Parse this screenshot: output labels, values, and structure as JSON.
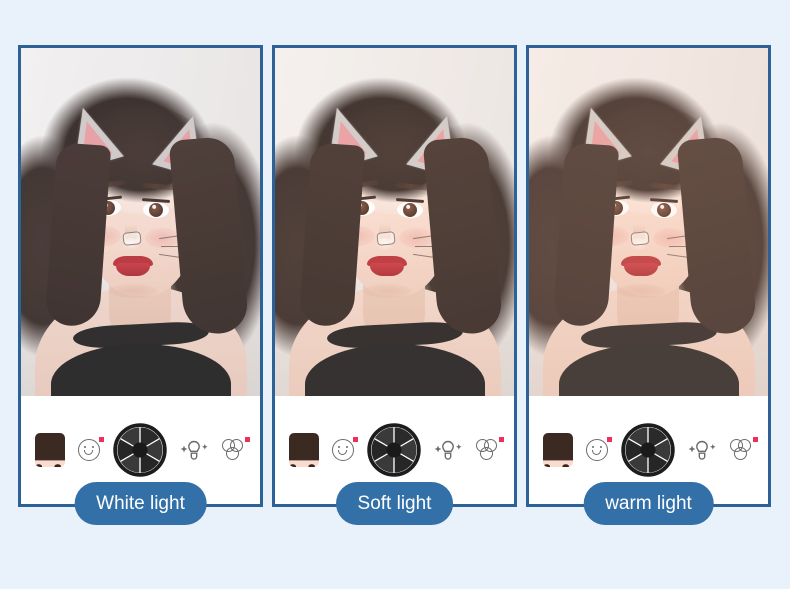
{
  "page": {
    "background_color": "#e9f1fa",
    "panel_border_color": "#2c6298",
    "pill_color": "#3470a8",
    "badge_color": "#ef2f55"
  },
  "panels": [
    {
      "id": "white-light",
      "label": "White light",
      "tint": "white",
      "toolbar": {
        "gallery": "gallery-thumbnail",
        "effects": "smiley-effects-icon",
        "shutter": "camera-shutter-button",
        "beauty": "beauty-wand-icon",
        "filters": "color-filters-icon"
      }
    },
    {
      "id": "soft-light",
      "label": "Soft light",
      "tint": "soft",
      "toolbar": {
        "gallery": "gallery-thumbnail",
        "effects": "smiley-effects-icon",
        "shutter": "camera-shutter-button",
        "beauty": "beauty-wand-icon",
        "filters": "color-filters-icon"
      }
    },
    {
      "id": "warm-light",
      "label": "warm light",
      "tint": "warm",
      "toolbar": {
        "gallery": "gallery-thumbnail",
        "effects": "smiley-effects-icon",
        "shutter": "camera-shutter-button",
        "beauty": "beauty-wand-icon",
        "filters": "color-filters-icon"
      }
    }
  ]
}
